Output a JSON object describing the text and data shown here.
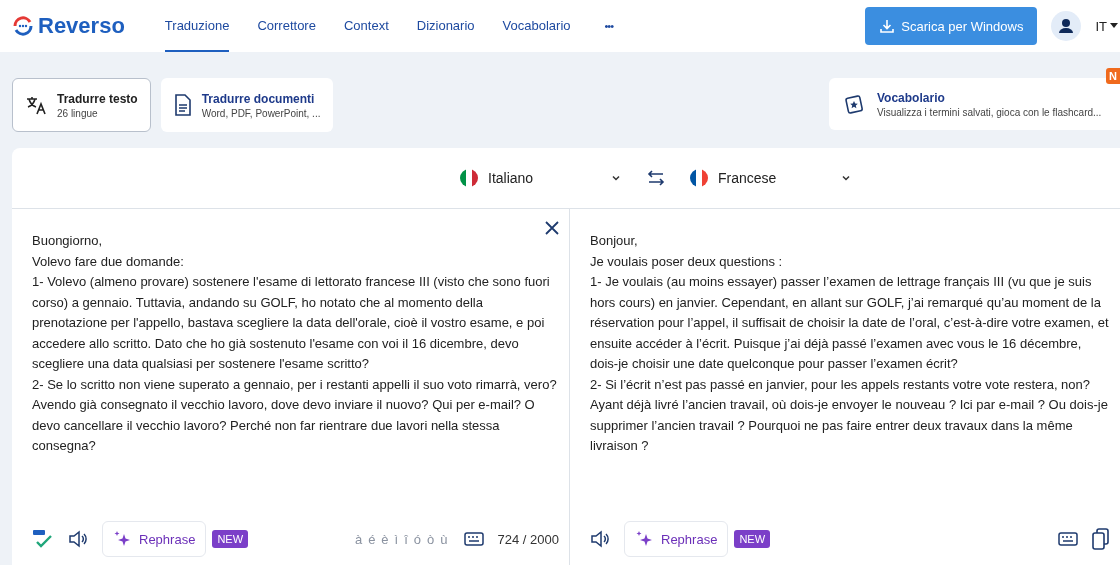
{
  "header": {
    "logo": "Reverso",
    "nav": [
      {
        "label": "Traduzione",
        "selected": true
      },
      {
        "label": "Correttore",
        "selected": false
      },
      {
        "label": "Context",
        "selected": false
      },
      {
        "label": "Dizionario",
        "selected": false
      },
      {
        "label": "Vocabolario",
        "selected": false
      }
    ],
    "more": "•••",
    "download": "Scarica per Windows",
    "language": "IT"
  },
  "modes": [
    {
      "kind": "text",
      "title": "Tradurre testo",
      "subtitle": "26 lingue",
      "selected": true
    },
    {
      "kind": "document",
      "title": "Tradurre documenti",
      "subtitle": "Word, PDF, PowerPoint, ...",
      "selected": false
    }
  ],
  "promo": {
    "title": "Vocabolario",
    "subtitle": "Visualizza i termini salvati, gioca con le flashcard...",
    "badge": "N"
  },
  "source": {
    "language": "Italiano",
    "lines": [
      "Buongiorno,",
      "Volevo fare due domande:",
      "1- Volevo (almeno provare)  sostenere l'esame di lettorato francese III (visto che sono fuori corso) a gennaio. Tuttavia, andando su GOLF, ho notato che al momento della prenotazione per l'appello, bastava scegliere la data dell'orale, cioè il vostro esame, e poi accedere allo scritto. Dato che ho già sostenuto l'esame con voi il 16 dicembre, devo scegliere una data qualsiasi per sostenere l'esame scritto?",
      "2- Se lo scritto non viene superato a gennaio, per i restanti appelli il suo voto rimarrà, vero? Avendo già consegnato il vecchio lavoro, dove devo inviare il nuovo? Qui per e-mail? O devo cancellare il vecchio lavoro? Perché non far rientrare due lavori nella stessa consegna?"
    ],
    "rephrase": "Rephrase",
    "badge": "NEW",
    "accents": [
      "à",
      "é",
      "è",
      "ì",
      "î",
      "ó",
      "ò",
      "ù"
    ],
    "count": "724 / 2000"
  },
  "target": {
    "language": "Francese",
    "lines": [
      "Bonjour,",
      "Je voulais poser deux questions :",
      "1- Je voulais (au moins essayer) passer l’examen de lettrage français III (vu que je suis hors cours) en janvier. Cependant, en allant sur GOLF, j’ai remarqué qu’au moment de la réservation pour l’appel, il suffisait de choisir la date de l’oral, c’est-à-dire votre examen, et ensuite accéder à l’écrit. Puisque j’ai déjà passé l’examen avec vous le 16 décembre, dois-je choisir une date quelconque pour passer l’examen écrit?",
      "2- Si l’écrit n’est pas passé en janvier, pour les appels restants votre vote restera, non? Ayant déjà livré l’ancien travail, où dois-je envoyer le nouveau ? Ici par e-mail ? Ou dois-je supprimer l’ancien travail ? Pourquoi ne pas faire entrer deux travaux dans la même livraison ?"
    ],
    "rephrase": "Rephrase",
    "badge": "NEW"
  }
}
